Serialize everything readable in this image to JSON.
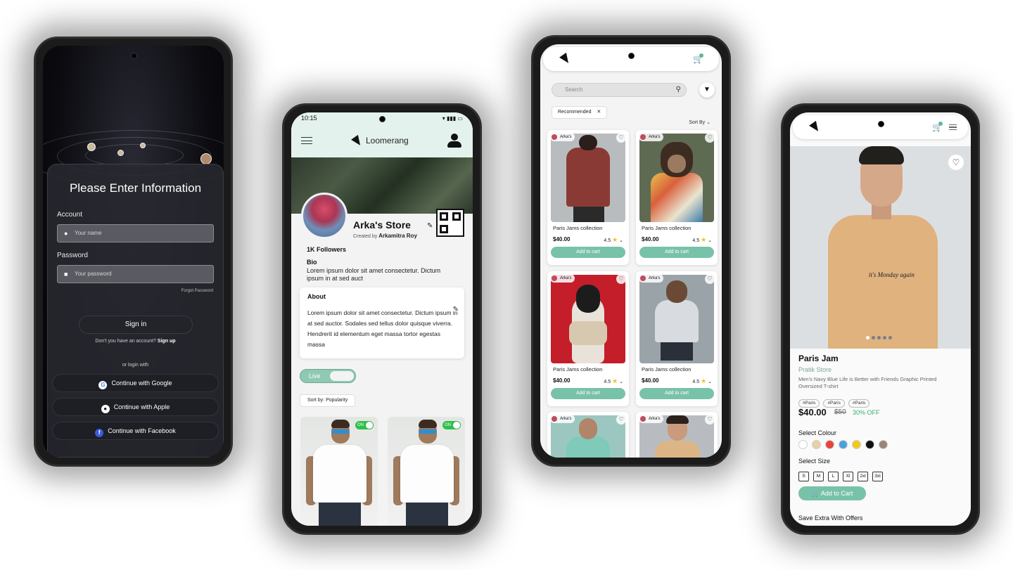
{
  "phone1": {
    "title": "Please Enter Information",
    "account_label": "Account",
    "name_placeholder": "Your name",
    "password_label": "Password",
    "password_placeholder": "Your password",
    "forgot": "Forgot Password",
    "signin": "Sign in",
    "no_account": "Don't you have an account?",
    "signup": "Sign up",
    "or_login": "or login with",
    "google": "Continue with Google",
    "apple": "Continue with Apple",
    "facebook": "Continue with Facebook"
  },
  "phone2": {
    "time": "10:15",
    "status_icons": "▾ ▮▮▮ ▭",
    "brand": "Loomerang",
    "store_name": "Arka's Store",
    "created_by": "Created by",
    "creator": "Arkamitra Roy",
    "followers": "1K Followers",
    "bio_heading": "Bio",
    "bio_text": "Lorem ipsum dolor sit amet consectetur. Dictum ipsum in at sed auct",
    "about_heading": "About",
    "about_text": "Lorem ipsum dolor sit amet consectetur. Dictum ipsum in at sed auctor. Sodales sed tellus dolor quisque viverra. Hendrerit id elementum eget massa tortor egestas massa",
    "live_label": "Live",
    "sort_label": "Sort by: Popularity",
    "toggle_on": "ON"
  },
  "phone3": {
    "search_placeholder": "Search",
    "chip": "Recommended",
    "sort_by": "Sort By",
    "cards": [
      {
        "tag": "Arka's",
        "title": "Paris Jams collection",
        "price": "$40.00",
        "rating": "4.5",
        "add": "Add to cart"
      },
      {
        "tag": "Arka's",
        "title": "Paris Jams collection",
        "price": "$40.00",
        "rating": "4.5",
        "add": "Add to cart"
      },
      {
        "tag": "Arka's",
        "title": "Paris Jams collection",
        "price": "$40.00",
        "rating": "4.5",
        "add": "Add to cart"
      },
      {
        "tag": "Arka's",
        "title": "Paris Jams collection",
        "price": "$40.00",
        "rating": "4.5",
        "add": "Add to cart"
      },
      {
        "tag": "Arka's"
      },
      {
        "tag": "Arka's"
      }
    ]
  },
  "phone4": {
    "print_text": "it's Monday again",
    "name": "Paris Jam",
    "store": "Pratik Store",
    "desc": "Men's Navy Blue Life is Better with Friends Graphic Printed Oversized T-shirt",
    "hashtags": [
      "#Paris",
      "#Paris",
      "#Paris"
    ],
    "price": "$40.00",
    "old_price": "$50",
    "discount": "30% OFF",
    "colour_heading": "Select Colour",
    "colours": [
      "#ffffff",
      "#e8cfa4",
      "#e8443d",
      "#4f9fe0",
      "#f3c81a",
      "#111111",
      "#9a8578"
    ],
    "size_heading": "Select Size",
    "sizes": [
      "S",
      "M",
      "L",
      "Xl",
      "2xl",
      "3xl"
    ],
    "add_to_cart": "Add to Cart",
    "save_extra": "Save Extra With Offers"
  },
  "colors": {
    "accent": "#79c2aa",
    "app_header": "#e3f2ed",
    "discount_green": "#33b36a"
  }
}
